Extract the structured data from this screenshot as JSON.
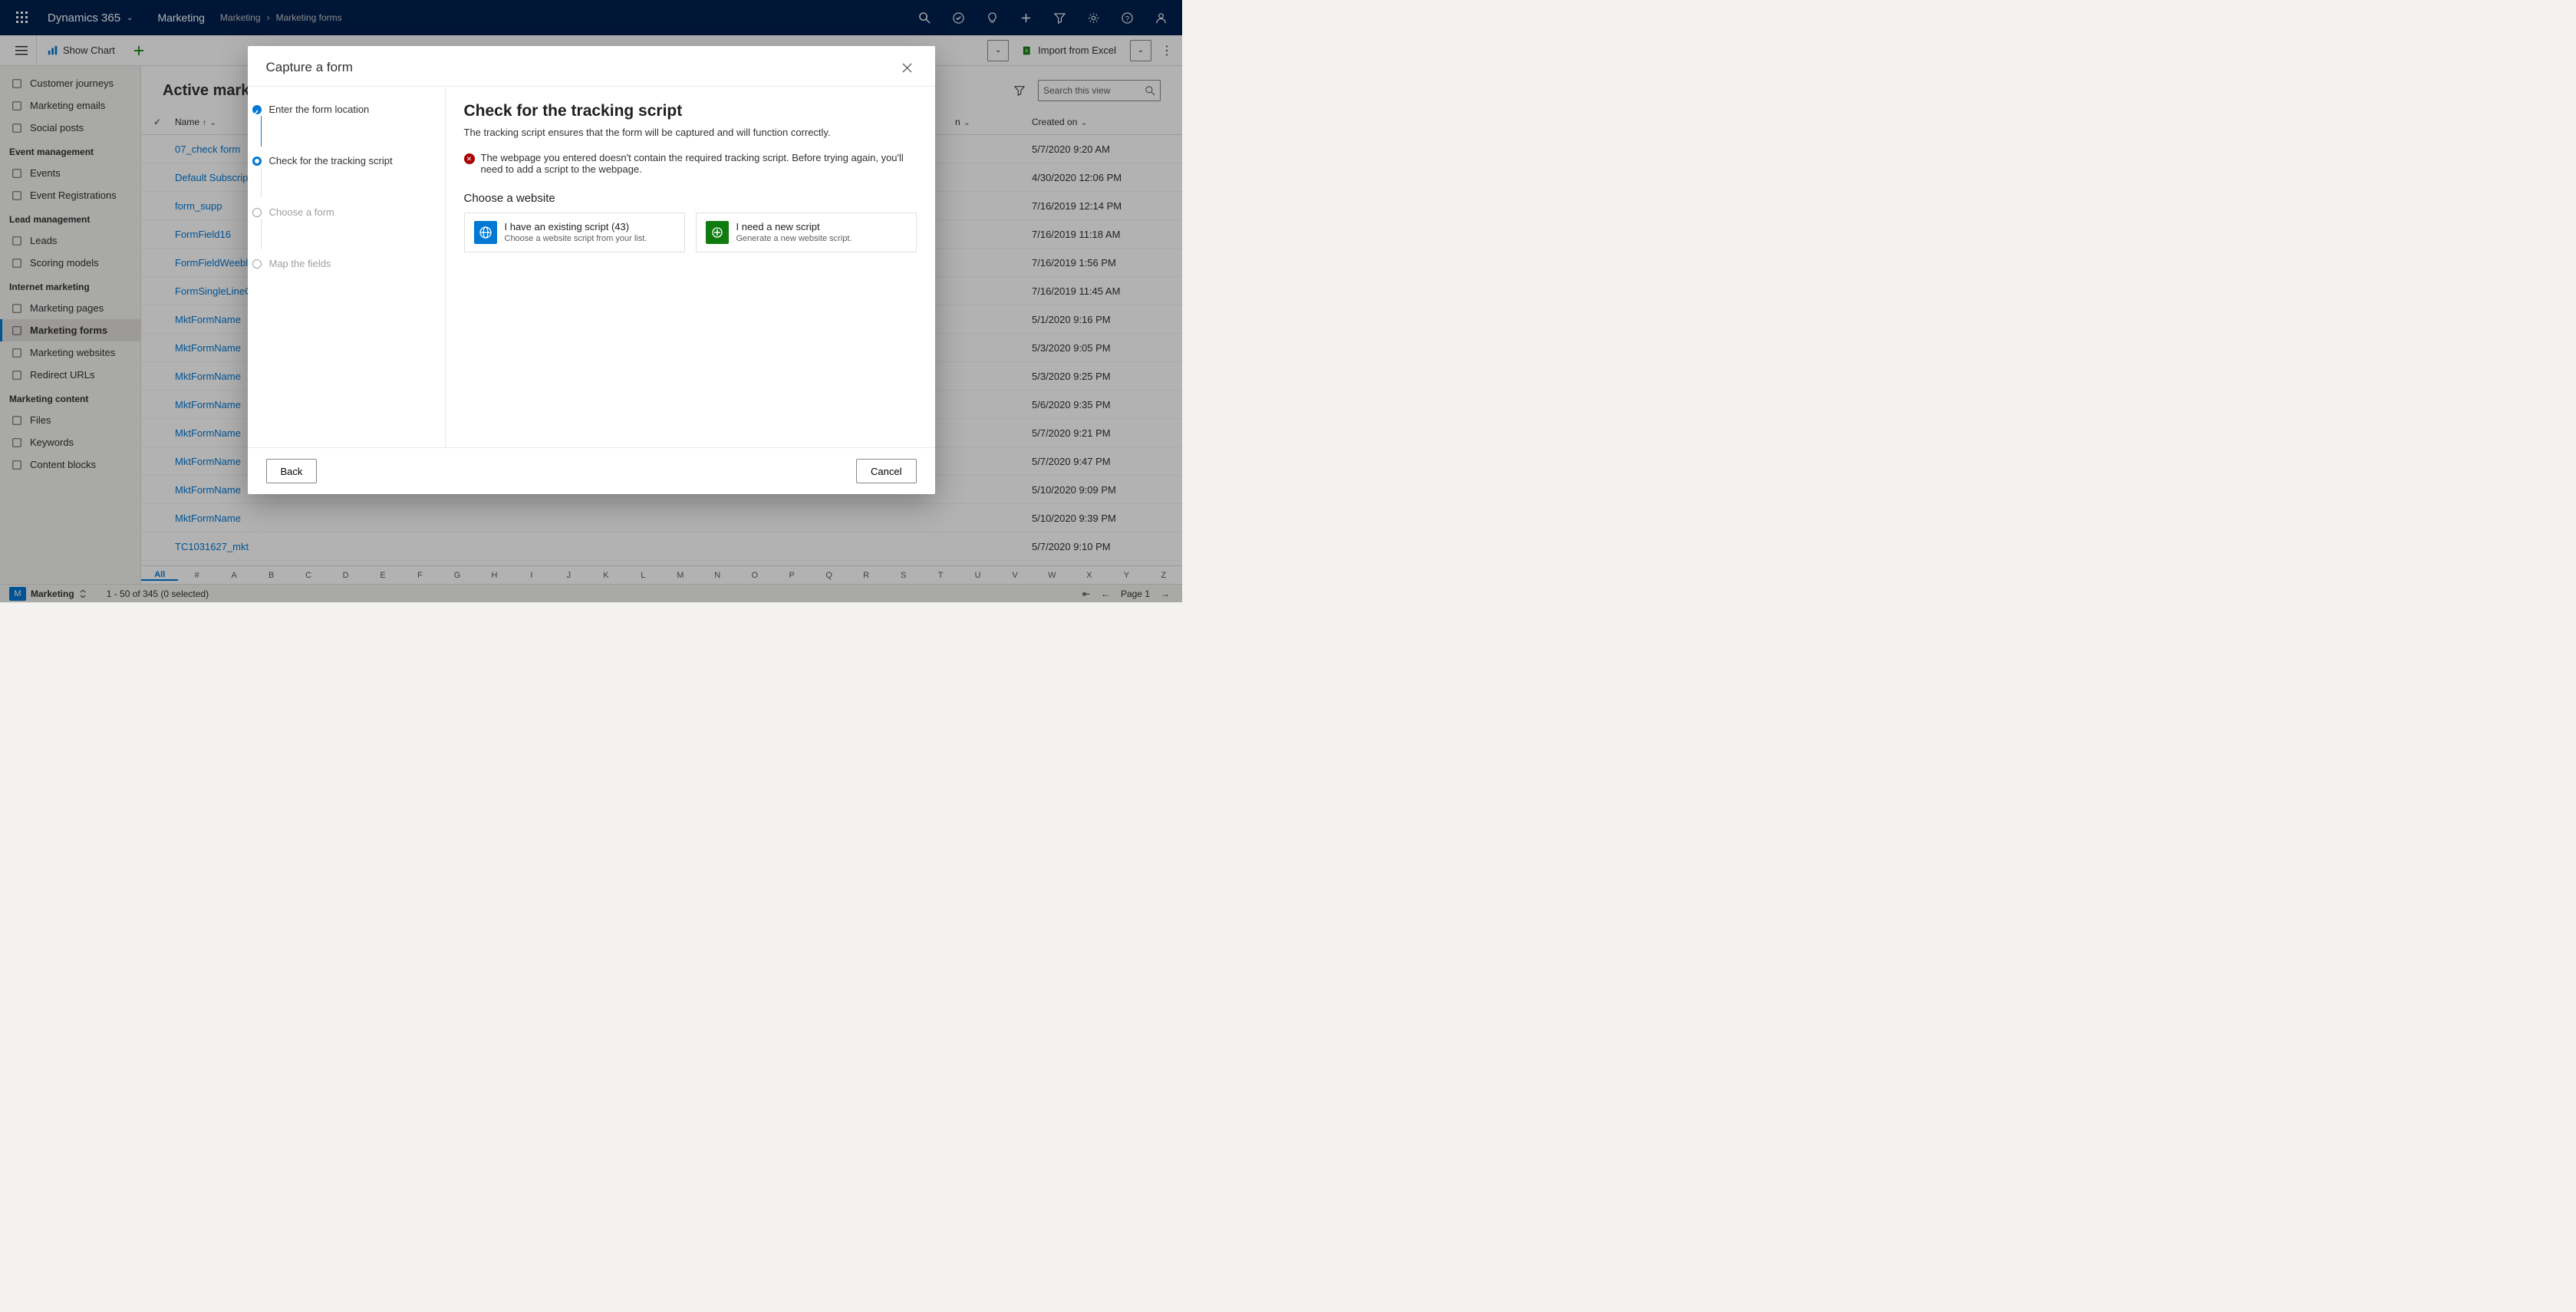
{
  "topbar": {
    "app": "Dynamics 365",
    "area": "Marketing",
    "crumb1": "Marketing",
    "crumb2": "Marketing forms"
  },
  "cmdbar": {
    "show_chart": "Show Chart",
    "import": "Import from Excel"
  },
  "sidebar": {
    "groups": [
      {
        "header": "",
        "items": [
          {
            "label": "Customer journeys",
            "icon": "journey"
          },
          {
            "label": "Marketing emails",
            "icon": "mail"
          },
          {
            "label": "Social posts",
            "icon": "clock"
          }
        ]
      },
      {
        "header": "Event management",
        "items": [
          {
            "label": "Events",
            "icon": "calendar"
          },
          {
            "label": "Event Registrations",
            "icon": "calendar"
          }
        ]
      },
      {
        "header": "Lead management",
        "items": [
          {
            "label": "Leads",
            "icon": "leads"
          },
          {
            "label": "Scoring models",
            "icon": "score"
          }
        ]
      },
      {
        "header": "Internet marketing",
        "items": [
          {
            "label": "Marketing pages",
            "icon": "page"
          },
          {
            "label": "Marketing forms",
            "icon": "form",
            "active": true
          },
          {
            "label": "Marketing websites",
            "icon": "site"
          },
          {
            "label": "Redirect URLs",
            "icon": "redirect"
          }
        ]
      },
      {
        "header": "Marketing content",
        "items": [
          {
            "label": "Files",
            "icon": "file"
          },
          {
            "label": "Keywords",
            "icon": "keyword"
          },
          {
            "label": "Content blocks",
            "icon": "block"
          }
        ]
      }
    ]
  },
  "view": {
    "title": "Active marke",
    "search_ph": "Search this view",
    "col_name": "Name",
    "col_created": "Created on"
  },
  "rows": [
    {
      "name": "07_check form",
      "created": "5/7/2020 9:20 AM"
    },
    {
      "name": "Default Subscrip",
      "created": "4/30/2020 12:06 PM"
    },
    {
      "name": "form_supp",
      "created": "7/16/2019 12:14 PM"
    },
    {
      "name": "FormField16",
      "created": "7/16/2019 11:18 AM"
    },
    {
      "name": "FormFieldWeebl",
      "created": "7/16/2019 1:56 PM"
    },
    {
      "name": "FormSingleLineO",
      "created": "7/16/2019 11:45 AM"
    },
    {
      "name": "MktFormName",
      "created": "5/1/2020 9:16 PM"
    },
    {
      "name": "MktFormName",
      "created": "5/3/2020 9:05 PM"
    },
    {
      "name": "MktFormName",
      "created": "5/3/2020 9:25 PM"
    },
    {
      "name": "MktFormName",
      "created": "5/6/2020 9:35 PM"
    },
    {
      "name": "MktFormName",
      "created": "5/7/2020 9:21 PM"
    },
    {
      "name": "MktFormName",
      "created": "5/7/2020 9:47 PM"
    },
    {
      "name": "MktFormName",
      "created": "5/10/2020 9:09 PM"
    },
    {
      "name": "MktFormName",
      "created": "5/10/2020 9:39 PM"
    },
    {
      "name": "TC1031627_mkt",
      "created": "5/7/2020 9:10 PM"
    }
  ],
  "alpha": [
    "All",
    "#",
    "A",
    "B",
    "C",
    "D",
    "E",
    "F",
    "G",
    "H",
    "I",
    "J",
    "K",
    "L",
    "M",
    "N",
    "O",
    "P",
    "Q",
    "R",
    "S",
    "T",
    "U",
    "V",
    "W",
    "X",
    "Y",
    "Z"
  ],
  "status": {
    "area_letter": "M",
    "area": "Marketing",
    "counts": "1 - 50 of 345 (0 selected)",
    "page": "Page 1"
  },
  "dialog": {
    "title": "Capture a form",
    "steps": {
      "s1": "Enter the form location",
      "s2": "Check for the tracking script",
      "s3": "Choose a form",
      "s4": "Map the fields"
    },
    "heading": "Check for the tracking script",
    "subtitle": "The tracking script ensures that the form will be captured and will function correctly.",
    "error": "The webpage you entered doesn't contain the required tracking script. Before trying again, you'll need to add a script to the webpage.",
    "choose": "Choose a website",
    "card1_title": "I have an existing script (43)",
    "card1_sub": "Choose a website script from your list.",
    "card2_title": "I need a new script",
    "card2_sub": "Generate a new website script.",
    "back": "Back",
    "cancel": "Cancel"
  }
}
